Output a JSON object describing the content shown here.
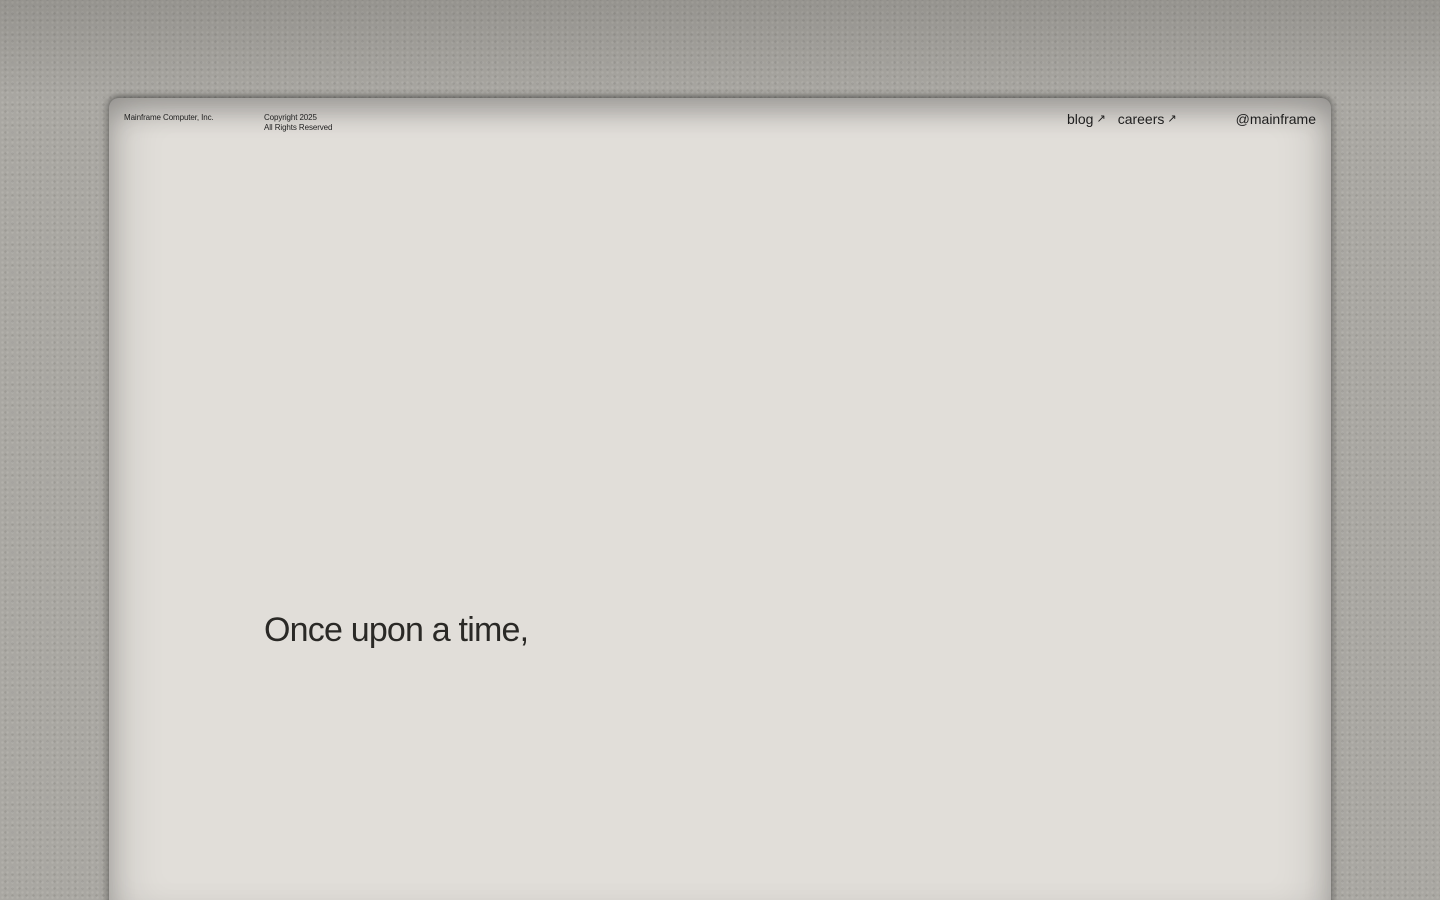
{
  "header": {
    "company": "Mainframe Computer, Inc.",
    "copyright_line1": "Copyright 2025",
    "copyright_line2": "All Rights Reserved",
    "nav": [
      {
        "label": "blog",
        "arrow": "↗"
      },
      {
        "label": "careers",
        "arrow": "↗"
      }
    ],
    "handle": "@mainframe"
  },
  "hero": {
    "text": "Once upon a time,"
  },
  "colors": {
    "background": "#a9a7a2",
    "panel": "#e1ded9",
    "text": "#1e1e1e"
  },
  "icons": {
    "external_link": "north-east-arrow-icon"
  }
}
